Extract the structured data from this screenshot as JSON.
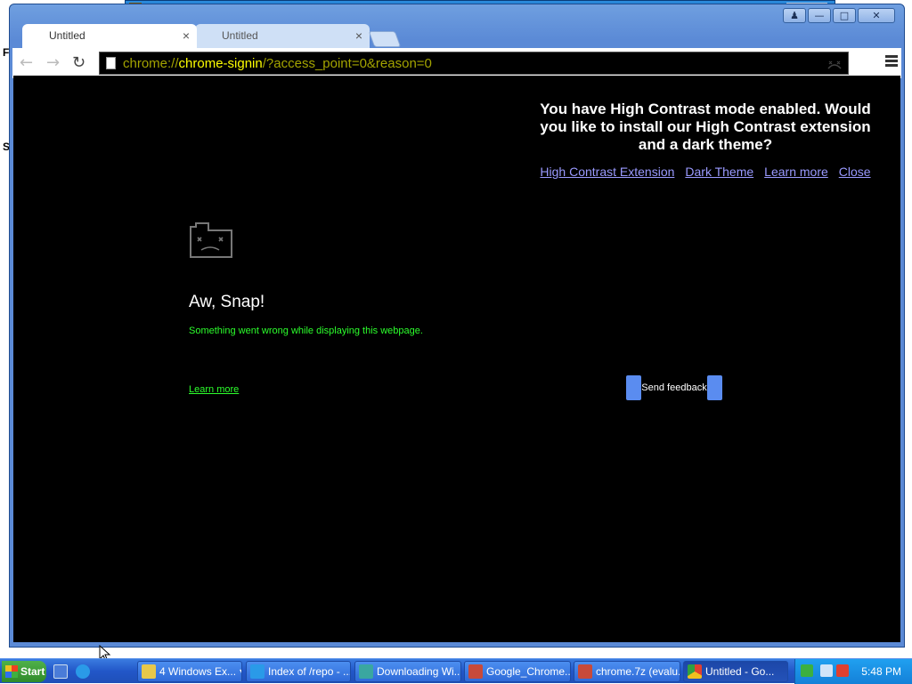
{
  "browser": {
    "tabs": [
      {
        "label": "Untitled",
        "close": "×"
      },
      {
        "label": "Untitled",
        "close": "×"
      }
    ],
    "nav": {
      "back": "←",
      "forward": "→",
      "reload": "↻"
    },
    "url": {
      "scheme": "chrome://",
      "host": "chrome-signin",
      "query": "/?access_point=0&reason=0"
    }
  },
  "window_controls": {
    "account": "♟",
    "minimize": "—",
    "maximize": "□",
    "close": "✕"
  },
  "high_contrast": {
    "message": "You have High Contrast mode enabled. Would you like to install our High Contrast extension and a dark theme?",
    "links": [
      "High Contrast Extension",
      "Dark Theme",
      "Learn more",
      "Close"
    ],
    "link_color": "#9a9aff"
  },
  "error": {
    "title": "Aw, Snap!",
    "message": "Something went wrong while displaying this webpage.",
    "learn_more": "Learn more",
    "feedback_button": "Send feedback",
    "message_color": "#2cff2c"
  },
  "desktop": {
    "letters": [
      "F",
      "S"
    ]
  },
  "taskbar": {
    "start": "Start",
    "tasks": [
      {
        "label": "4 Windows Ex...",
        "dropdown": "▾"
      },
      {
        "label": "Index of /repo - ..."
      },
      {
        "label": "Downloading Wi..."
      },
      {
        "label": "Google_Chrome..."
      },
      {
        "label": "chrome.7z (evalu..."
      },
      {
        "label": "Untitled - Go..."
      }
    ],
    "clock": "5:48 PM"
  }
}
